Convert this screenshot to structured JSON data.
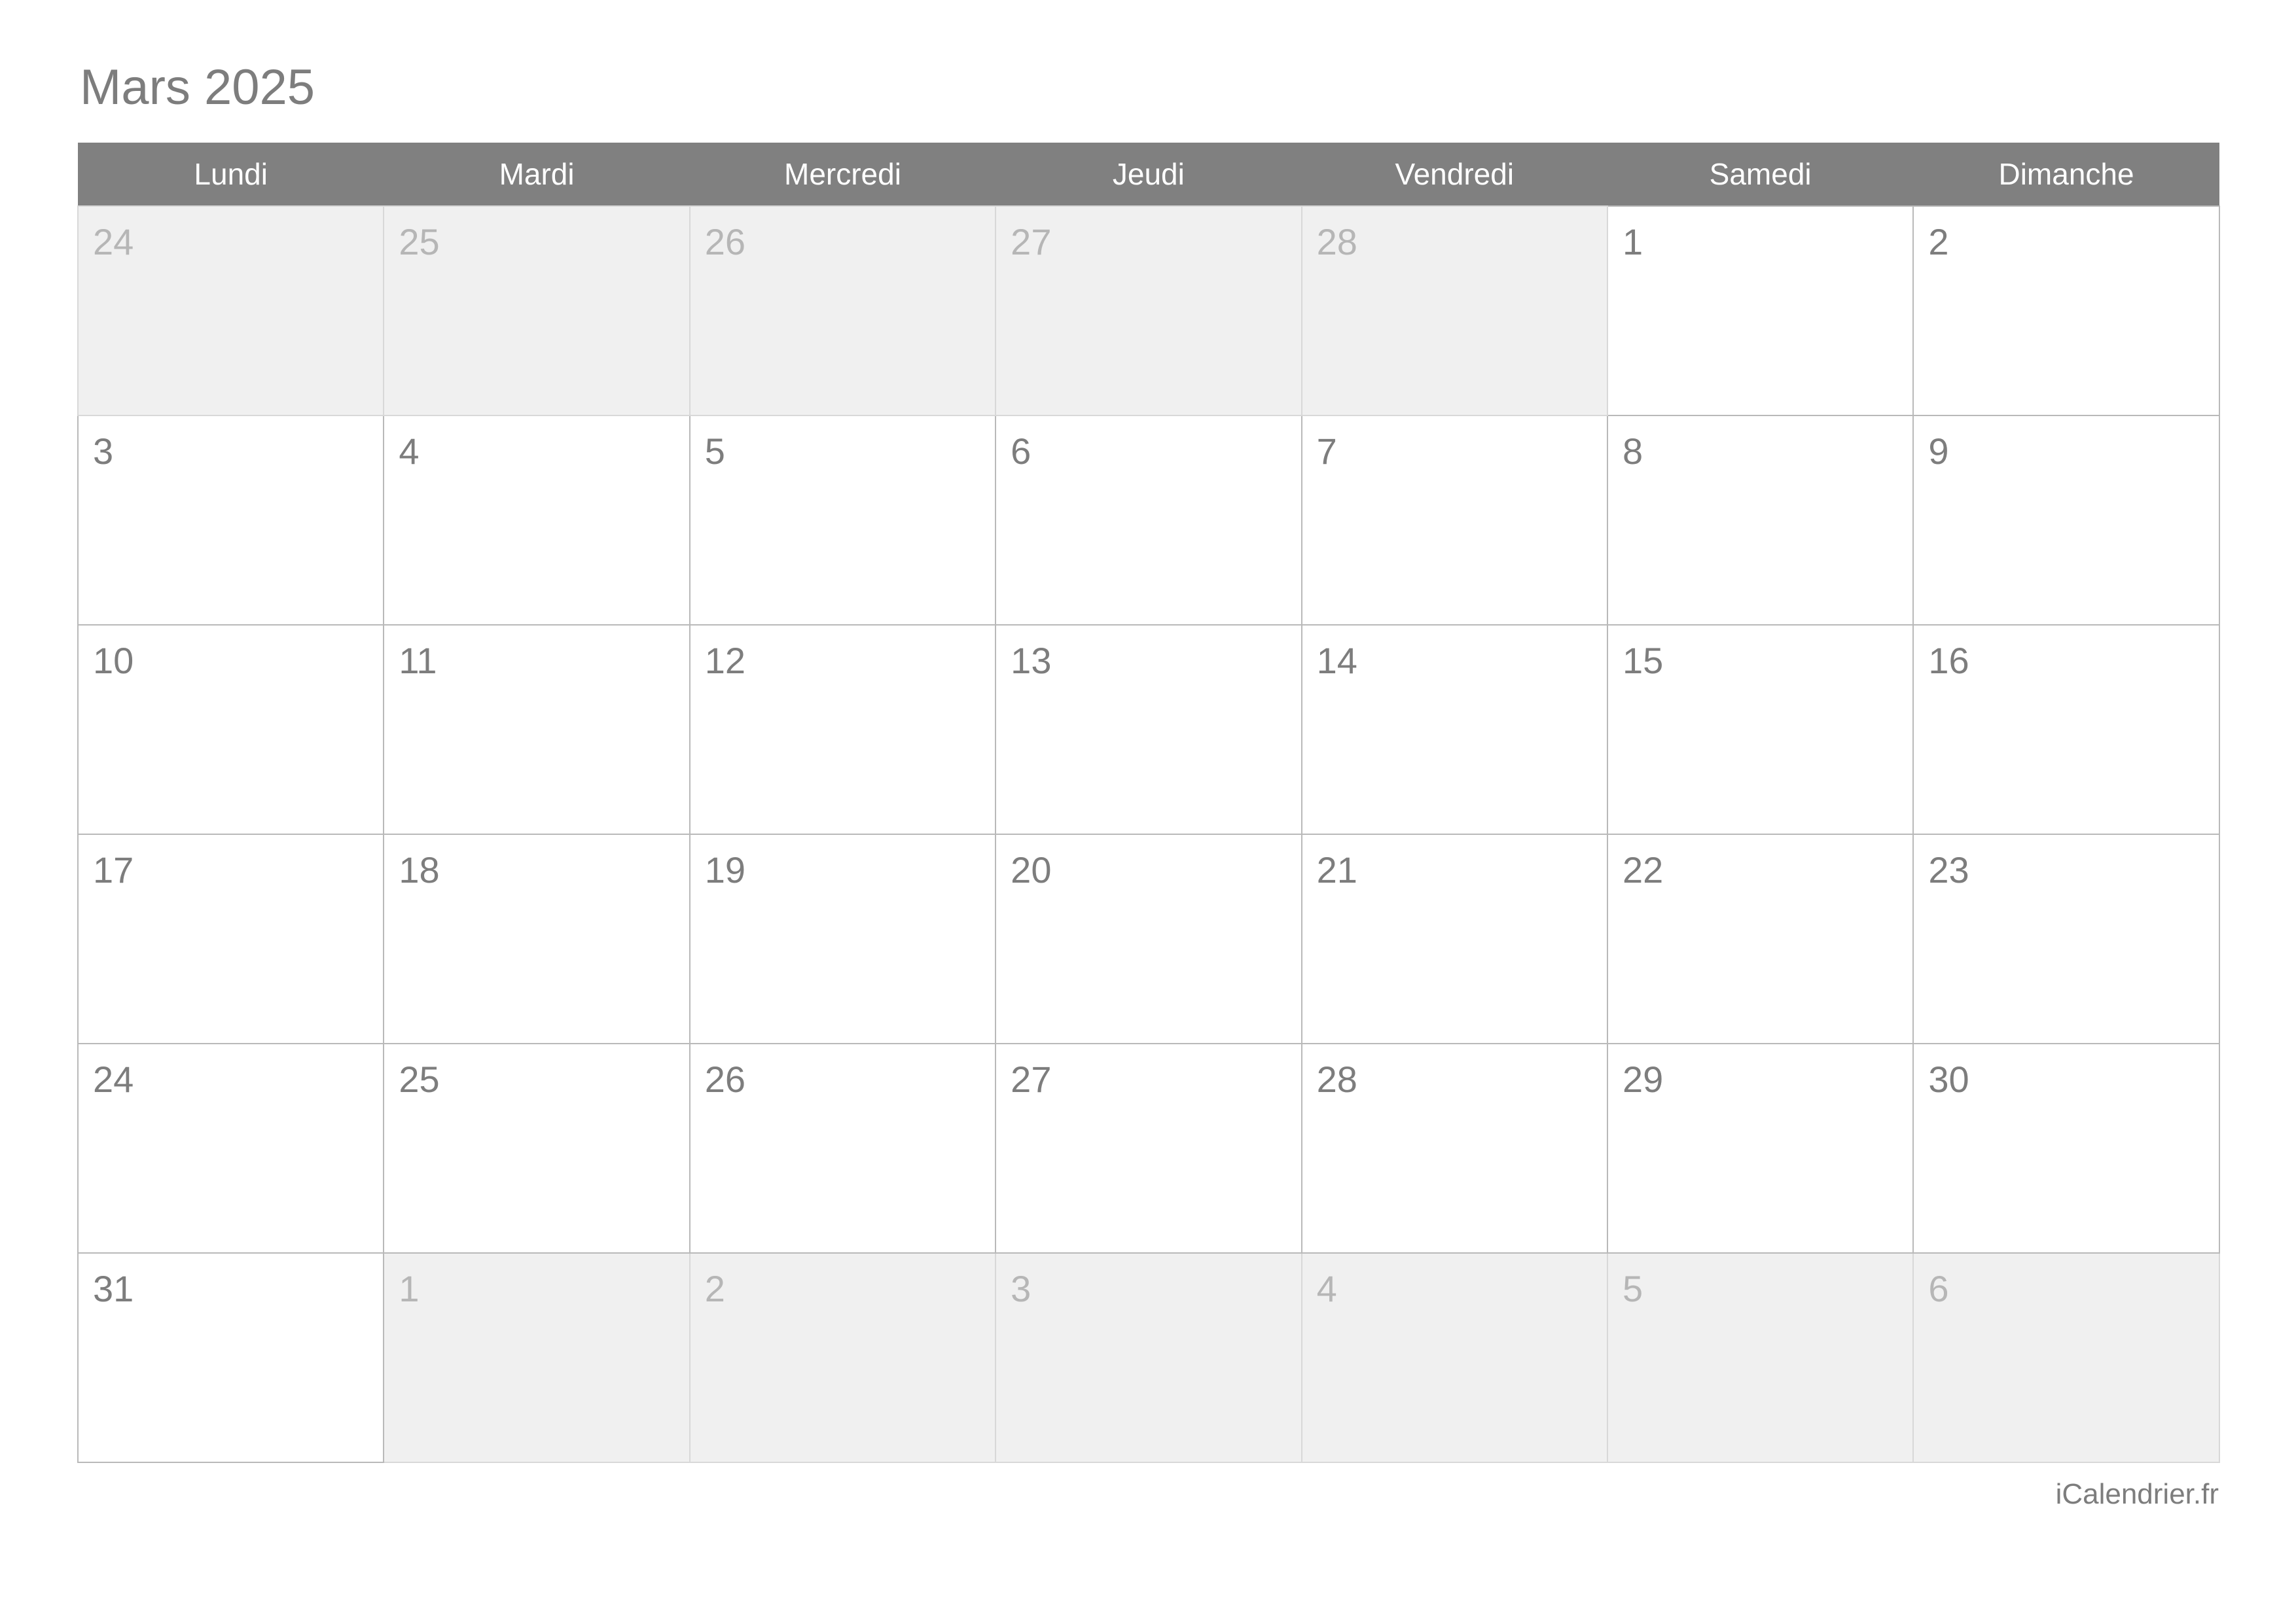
{
  "title": "Mars 2025",
  "weekdays": [
    "Lundi",
    "Mardi",
    "Mercredi",
    "Jeudi",
    "Vendredi",
    "Samedi",
    "Dimanche"
  ],
  "footer": "iCalendrier.fr",
  "colors": {
    "header_bg": "#808080",
    "header_text": "#ffffff",
    "title_text": "#7d7d7d",
    "in_month_bg": "#ffffff",
    "in_month_text": "#7d7d7d",
    "out_month_bg": "#f0f0f0",
    "out_month_text": "#b6b6b6",
    "grid_border": "#b9b9b9"
  },
  "weeks": [
    [
      {
        "n": "24",
        "out": true
      },
      {
        "n": "25",
        "out": true
      },
      {
        "n": "26",
        "out": true
      },
      {
        "n": "27",
        "out": true
      },
      {
        "n": "28",
        "out": true
      },
      {
        "n": "1",
        "out": false
      },
      {
        "n": "2",
        "out": false
      }
    ],
    [
      {
        "n": "3",
        "out": false
      },
      {
        "n": "4",
        "out": false
      },
      {
        "n": "5",
        "out": false
      },
      {
        "n": "6",
        "out": false
      },
      {
        "n": "7",
        "out": false
      },
      {
        "n": "8",
        "out": false
      },
      {
        "n": "9",
        "out": false
      }
    ],
    [
      {
        "n": "10",
        "out": false
      },
      {
        "n": "11",
        "out": false
      },
      {
        "n": "12",
        "out": false
      },
      {
        "n": "13",
        "out": false
      },
      {
        "n": "14",
        "out": false
      },
      {
        "n": "15",
        "out": false
      },
      {
        "n": "16",
        "out": false
      }
    ],
    [
      {
        "n": "17",
        "out": false
      },
      {
        "n": "18",
        "out": false
      },
      {
        "n": "19",
        "out": false
      },
      {
        "n": "20",
        "out": false
      },
      {
        "n": "21",
        "out": false
      },
      {
        "n": "22",
        "out": false
      },
      {
        "n": "23",
        "out": false
      }
    ],
    [
      {
        "n": "24",
        "out": false
      },
      {
        "n": "25",
        "out": false
      },
      {
        "n": "26",
        "out": false
      },
      {
        "n": "27",
        "out": false
      },
      {
        "n": "28",
        "out": false
      },
      {
        "n": "29",
        "out": false
      },
      {
        "n": "30",
        "out": false
      }
    ],
    [
      {
        "n": "31",
        "out": false
      },
      {
        "n": "1",
        "out": true
      },
      {
        "n": "2",
        "out": true
      },
      {
        "n": "3",
        "out": true
      },
      {
        "n": "4",
        "out": true
      },
      {
        "n": "5",
        "out": true
      },
      {
        "n": "6",
        "out": true
      }
    ]
  ]
}
